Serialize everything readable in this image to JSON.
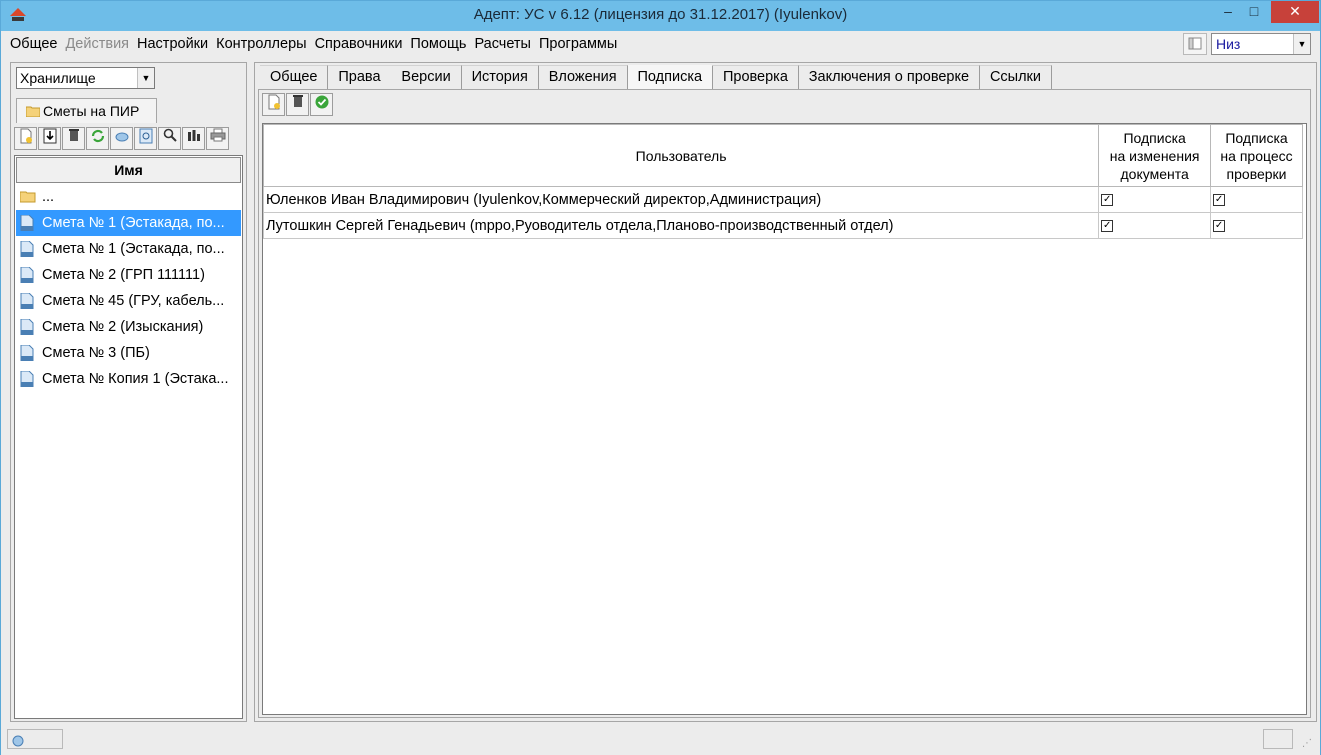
{
  "window": {
    "title": "Адепт: УС  v 6.12 (лицензия до 31.12.2017) (Iyulenkov)",
    "minimize": "–",
    "maximize": "□",
    "close": "✕"
  },
  "menu": [
    "Общее",
    "Действия",
    "Настройки",
    "Контроллеры",
    "Справочники",
    "Помощь",
    "Расчеты",
    "Программы"
  ],
  "layout_select": {
    "value": "Низ"
  },
  "left": {
    "storage_select": "Хранилище",
    "folder_tab": "Сметы на ПИР",
    "list_header": "Имя",
    "items": [
      {
        "label": "...",
        "icon": "folder-icon"
      },
      {
        "label": "Смета № 1 (Эстакада, по...",
        "icon": "document-icon",
        "selected": true
      },
      {
        "label": "Смета № 1 (Эстакада, по...",
        "icon": "document-icon"
      },
      {
        "label": "Смета № 2 (ГРП 111111)",
        "icon": "document-icon"
      },
      {
        "label": "Смета № 45 (ГРУ, кабель...",
        "icon": "document-icon"
      },
      {
        "label": "Смета № 2 (Изыскания)",
        "icon": "document-icon"
      },
      {
        "label": "Смета № 3 (ПБ)",
        "icon": "document-icon"
      },
      {
        "label": "Смета № Копия 1 (Эстака...",
        "icon": "document-icon"
      }
    ]
  },
  "tabs": [
    "Общее",
    "Права",
    "Версии",
    "История",
    "Вложения",
    "Подписка",
    "Проверка",
    "Заключения о проверке",
    "Ссылки"
  ],
  "active_tab": "Подписка",
  "grid": {
    "col_user": "Пользователь",
    "col_doc_line1": "Подписка",
    "col_doc_line2": "на изменения",
    "col_doc_line3": "документа",
    "col_check_line1": "Подписка",
    "col_check_line2": "на процесс",
    "col_check_line3": "проверки",
    "rows": [
      {
        "user": "Юленков Иван Владимирович (Iyulenkov,Коммерческий директор,Администрация)",
        "doc": true,
        "check": true
      },
      {
        "user": "Лутошкин Сергей Генадьевич (mppo,Руоводитель отдела,Планово-производственный отдел)",
        "doc": true,
        "check": true
      }
    ]
  }
}
